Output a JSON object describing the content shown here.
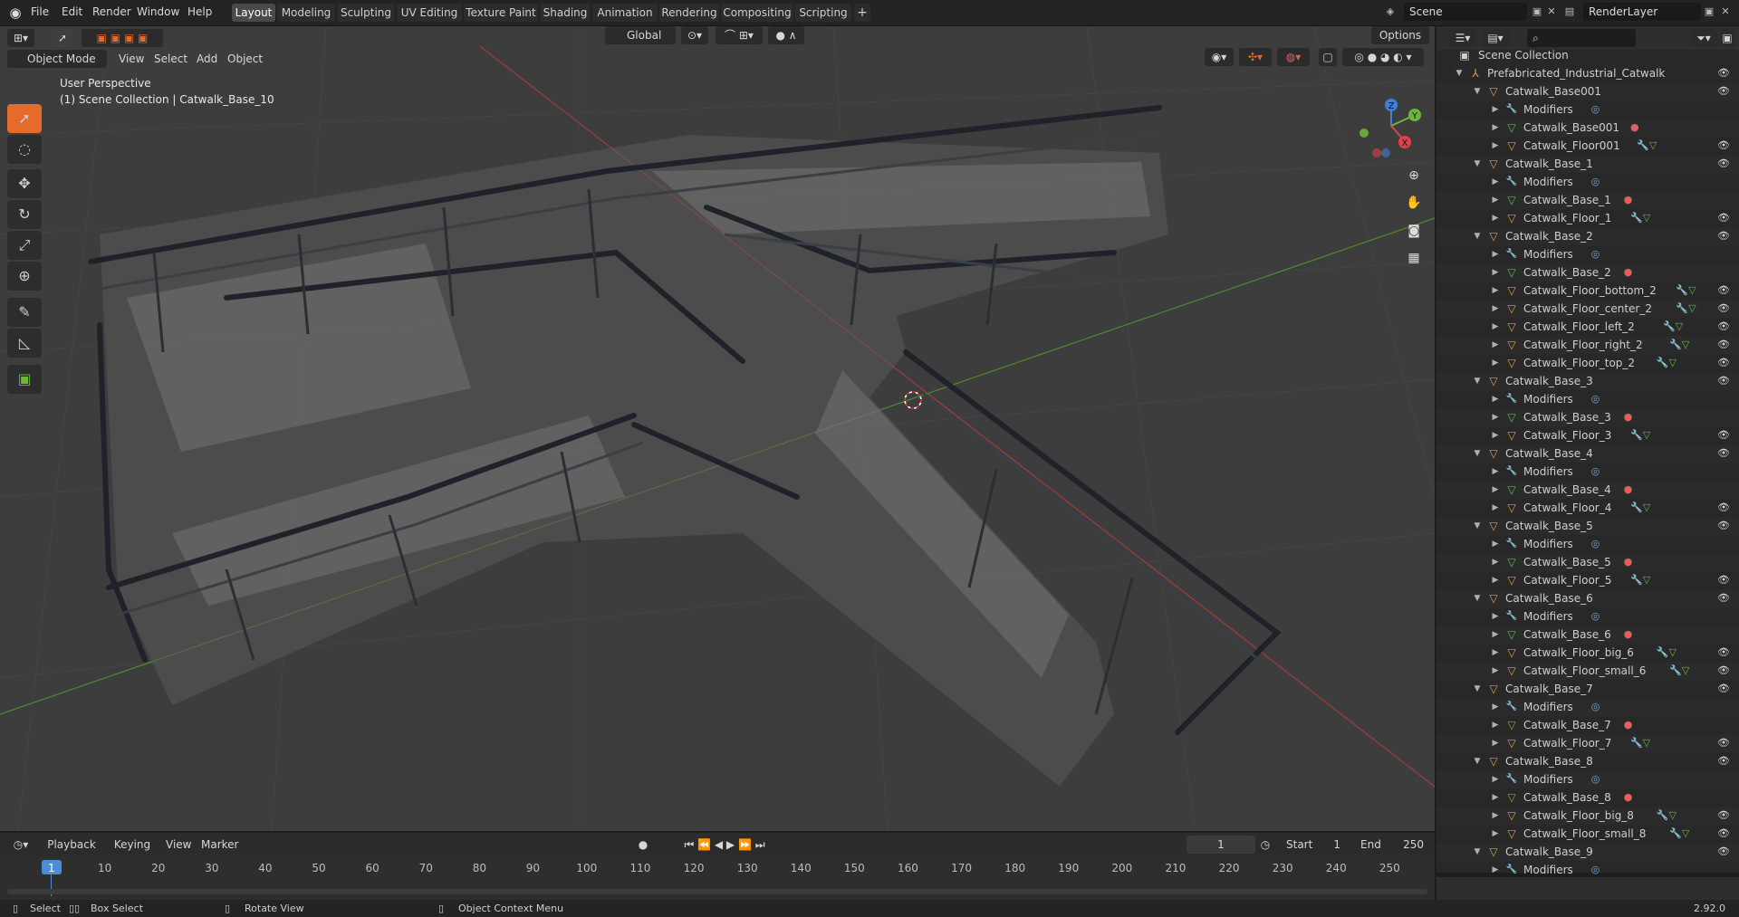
{
  "topbar": {
    "menus": [
      "File",
      "Edit",
      "Render",
      "Window",
      "Help"
    ],
    "workspaces": [
      "Layout",
      "Modeling",
      "Sculpting",
      "UV Editing",
      "Texture Paint",
      "Shading",
      "Animation",
      "Rendering",
      "Compositing",
      "Scripting"
    ],
    "active_workspace": "Layout",
    "scene": "Scene",
    "render_layer": "RenderLayer"
  },
  "viewport": {
    "mode": "Object Mode",
    "menus": [
      "View",
      "Select",
      "Add",
      "Object"
    ],
    "orientation": "Global",
    "options_label": "Options",
    "perspective_label": "User Perspective",
    "context_label": "(1) Scene Collection | Catwalk_Base_10",
    "gizmo": {
      "x": "X",
      "y": "Y",
      "z": "Z"
    },
    "colors": {
      "x_axis": "#a33b3b",
      "y_axis": "#4e8b2a",
      "gizmo_x": "#e0414d",
      "gizmo_y": "#6ab73a",
      "gizmo_z": "#3f7fd6"
    }
  },
  "outliner": {
    "root": "Scene Collection",
    "items": [
      {
        "depth": 1,
        "label": "Prefabricated_Industrial_Catwalk",
        "icon": "armature-icon",
        "eye": true
      },
      {
        "depth": 2,
        "label": "Catwalk_Base001",
        "icon": "empty-icon",
        "eye": true
      },
      {
        "depth": 3,
        "label": "Modifiers",
        "icon": "wrench-icon",
        "extra": "modifier"
      },
      {
        "depth": 3,
        "label": "Catwalk_Base001",
        "icon": "mesh-icon",
        "extra": "material"
      },
      {
        "depth": 3,
        "label": "Catwalk_Floor001",
        "icon": "object-icon",
        "extra": "mod-mesh",
        "eye": true
      },
      {
        "depth": 2,
        "label": "Catwalk_Base_1",
        "icon": "empty-icon",
        "eye": true
      },
      {
        "depth": 3,
        "label": "Modifiers",
        "icon": "wrench-icon",
        "extra": "modifier"
      },
      {
        "depth": 3,
        "label": "Catwalk_Base_1",
        "icon": "mesh-icon",
        "extra": "material"
      },
      {
        "depth": 3,
        "label": "Catwalk_Floor_1",
        "icon": "object-icon",
        "extra": "mod-mesh",
        "eye": true
      },
      {
        "depth": 2,
        "label": "Catwalk_Base_2",
        "icon": "empty-icon",
        "eye": true
      },
      {
        "depth": 3,
        "label": "Modifiers",
        "icon": "wrench-icon",
        "extra": "modifier"
      },
      {
        "depth": 3,
        "label": "Catwalk_Base_2",
        "icon": "mesh-icon",
        "extra": "material"
      },
      {
        "depth": 3,
        "label": "Catwalk_Floor_bottom_2",
        "icon": "object-icon",
        "extra": "mod-mesh",
        "eye": true
      },
      {
        "depth": 3,
        "label": "Catwalk_Floor_center_2",
        "icon": "object-icon",
        "extra": "mod-mesh",
        "eye": true
      },
      {
        "depth": 3,
        "label": "Catwalk_Floor_left_2",
        "icon": "object-icon",
        "extra": "mod-mesh",
        "eye": true
      },
      {
        "depth": 3,
        "label": "Catwalk_Floor_right_2",
        "icon": "object-icon",
        "extra": "mod-mesh",
        "eye": true
      },
      {
        "depth": 3,
        "label": "Catwalk_Floor_top_2",
        "icon": "object-icon",
        "extra": "mod-mesh",
        "eye": true
      },
      {
        "depth": 2,
        "label": "Catwalk_Base_3",
        "icon": "empty-icon",
        "eye": true
      },
      {
        "depth": 3,
        "label": "Modifiers",
        "icon": "wrench-icon",
        "extra": "modifier"
      },
      {
        "depth": 3,
        "label": "Catwalk_Base_3",
        "icon": "mesh-icon",
        "extra": "material"
      },
      {
        "depth": 3,
        "label": "Catwalk_Floor_3",
        "icon": "object-icon",
        "extra": "mod-mesh",
        "eye": true
      },
      {
        "depth": 2,
        "label": "Catwalk_Base_4",
        "icon": "empty-icon",
        "eye": true
      },
      {
        "depth": 3,
        "label": "Modifiers",
        "icon": "wrench-icon",
        "extra": "modifier"
      },
      {
        "depth": 3,
        "label": "Catwalk_Base_4",
        "icon": "mesh-icon",
        "extra": "material"
      },
      {
        "depth": 3,
        "label": "Catwalk_Floor_4",
        "icon": "object-icon",
        "extra": "mod-mesh",
        "eye": true
      },
      {
        "depth": 2,
        "label": "Catwalk_Base_5",
        "icon": "empty-icon",
        "eye": true
      },
      {
        "depth": 3,
        "label": "Modifiers",
        "icon": "wrench-icon",
        "extra": "modifier"
      },
      {
        "depth": 3,
        "label": "Catwalk_Base_5",
        "icon": "mesh-icon",
        "extra": "material"
      },
      {
        "depth": 3,
        "label": "Catwalk_Floor_5",
        "icon": "object-icon",
        "extra": "mod-mesh",
        "eye": true
      },
      {
        "depth": 2,
        "label": "Catwalk_Base_6",
        "icon": "empty-icon",
        "eye": true
      },
      {
        "depth": 3,
        "label": "Modifiers",
        "icon": "wrench-icon",
        "extra": "modifier"
      },
      {
        "depth": 3,
        "label": "Catwalk_Base_6",
        "icon": "mesh-icon",
        "extra": "material"
      },
      {
        "depth": 3,
        "label": "Catwalk_Floor_big_6",
        "icon": "object-icon",
        "extra": "mod-mesh",
        "eye": true
      },
      {
        "depth": 3,
        "label": "Catwalk_Floor_small_6",
        "icon": "object-icon",
        "extra": "mod-mesh",
        "eye": true
      },
      {
        "depth": 2,
        "label": "Catwalk_Base_7",
        "icon": "empty-icon",
        "eye": true
      },
      {
        "depth": 3,
        "label": "Modifiers",
        "icon": "wrench-icon",
        "extra": "modifier"
      },
      {
        "depth": 3,
        "label": "Catwalk_Base_7",
        "icon": "mesh-icon",
        "extra": "material"
      },
      {
        "depth": 3,
        "label": "Catwalk_Floor_7",
        "icon": "object-icon",
        "extra": "mod-mesh",
        "eye": true
      },
      {
        "depth": 2,
        "label": "Catwalk_Base_8",
        "icon": "empty-icon",
        "eye": true
      },
      {
        "depth": 3,
        "label": "Modifiers",
        "icon": "wrench-icon",
        "extra": "modifier"
      },
      {
        "depth": 3,
        "label": "Catwalk_Base_8",
        "icon": "mesh-icon",
        "extra": "material"
      },
      {
        "depth": 3,
        "label": "Catwalk_Floor_big_8",
        "icon": "object-icon",
        "extra": "mod-mesh",
        "eye": true
      },
      {
        "depth": 3,
        "label": "Catwalk_Floor_small_8",
        "icon": "object-icon",
        "extra": "mod-mesh",
        "eye": true
      },
      {
        "depth": 2,
        "label": "Catwalk_Base_9",
        "icon": "empty-icon",
        "eye": true
      },
      {
        "depth": 3,
        "label": "Modifiers",
        "icon": "wrench-icon",
        "extra": "modifier"
      }
    ]
  },
  "timeline": {
    "menus": [
      "Playback",
      "Keying",
      "View",
      "Marker"
    ],
    "current_frame": "1",
    "start_label": "Start",
    "start": "1",
    "end_label": "End",
    "end": "250",
    "ticks": [
      "1",
      "10",
      "20",
      "30",
      "40",
      "50",
      "60",
      "70",
      "80",
      "90",
      "100",
      "110",
      "120",
      "130",
      "140",
      "150",
      "160",
      "170",
      "180",
      "190",
      "200",
      "210",
      "220",
      "230",
      "240",
      "250"
    ]
  },
  "statusbar": {
    "select": "Select",
    "box_select": "Box Select",
    "rotate_view": "Rotate View",
    "context_menu": "Object Context Menu",
    "version": "2.92.0"
  }
}
